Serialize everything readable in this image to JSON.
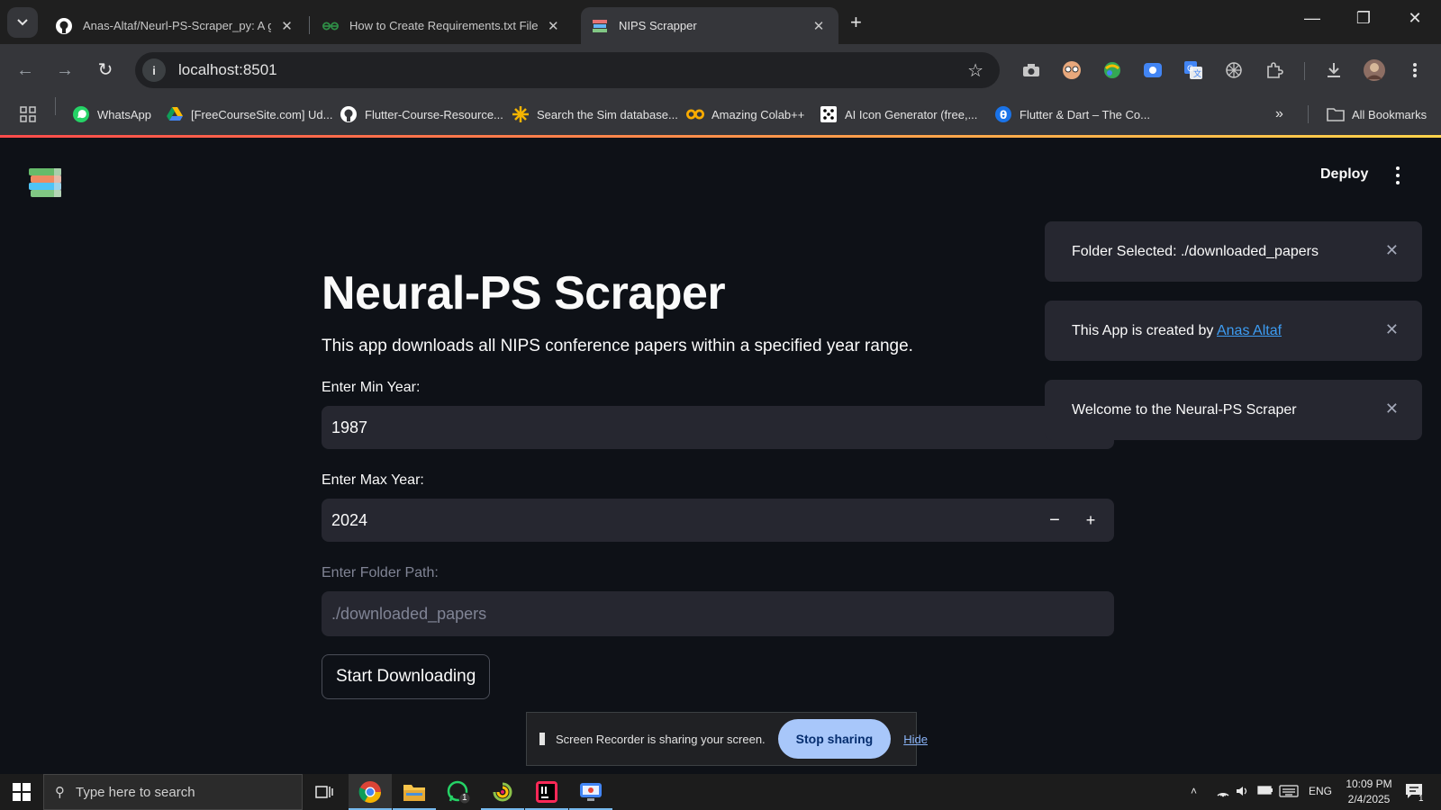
{
  "browser": {
    "tabs": [
      {
        "title": "Anas-Altaf/Neurl-PS-Scraper_py: A gu",
        "icon": "github-icon",
        "active": false
      },
      {
        "title": "How to Create Requirements.txt File i",
        "icon": "geeksforgeeks-icon",
        "active": false
      },
      {
        "title": "NIPS Scrapper",
        "icon": "streamlit-books-icon",
        "active": true
      }
    ],
    "url": "localhost:8501",
    "bookmarks": [
      {
        "label": "WhatsApp",
        "icon": "whatsapp-icon"
      },
      {
        "label": "[FreeCourseSite.com] Ud...",
        "icon": "google-drive-icon"
      },
      {
        "label": "Flutter-Course-Resource...",
        "icon": "github-icon"
      },
      {
        "label": "Search the Sim database...",
        "icon": "sim-icon"
      },
      {
        "label": "Amazing Colab++",
        "icon": "colab-icon"
      },
      {
        "label": "AI Icon Generator (free,...",
        "icon": "dice-icon"
      },
      {
        "label": "Flutter & Dart – The Co...",
        "icon": "udemy-icon"
      }
    ],
    "all_bookmarks_label": "All Bookmarks"
  },
  "app": {
    "deploy_label": "Deploy",
    "title": "Neural-PS Scraper",
    "description": "This app downloads all NIPS conference papers within a specified year range.",
    "min_year": {
      "label": "Enter Min Year:",
      "value": "1987"
    },
    "max_year": {
      "label": "Enter Max Year:",
      "value": "2024"
    },
    "folder": {
      "label": "Enter Folder Path:",
      "value": "./downloaded_papers"
    },
    "start_button": "Start Downloading"
  },
  "toasts": [
    {
      "text": "Folder Selected: ./downloaded_papers"
    },
    {
      "prefix": "This App is created by ",
      "link": "Anas Altaf"
    },
    {
      "text": "Welcome to the Neural-PS Scraper"
    }
  ],
  "recorder": {
    "message": "Screen Recorder is sharing your screen.",
    "stop_label": "Stop sharing",
    "hide_label": "Hide"
  },
  "taskbar": {
    "search_placeholder": "Type here to search",
    "language": "ENG",
    "time": "10:09 PM",
    "date": "2/4/2025",
    "whatsapp_badge": "1",
    "notification_badge": "1"
  }
}
